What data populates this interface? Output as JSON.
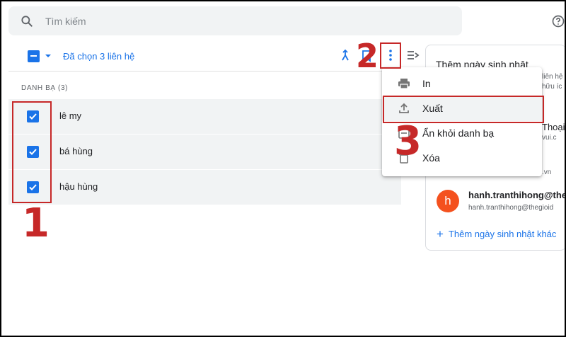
{
  "search": {
    "placeholder": "Tìm kiếm"
  },
  "toolbar": {
    "selected_label": "Đã chọn 3 liên hệ"
  },
  "list": {
    "heading": "DANH BẠ (3)",
    "contacts": [
      {
        "name": "lê my",
        "checked": true
      },
      {
        "name": "bá hùng",
        "checked": true
      },
      {
        "name": "hậu hùng",
        "checked": true
      }
    ]
  },
  "menu": {
    "items": [
      {
        "label": "In",
        "icon": "print-icon"
      },
      {
        "label": "Xuất",
        "icon": "export-icon"
      },
      {
        "label": "Ẩn khỏi danh bạ",
        "icon": "hide-contact-icon"
      },
      {
        "label": "Xóa",
        "icon": "delete-icon"
      }
    ]
  },
  "panel": {
    "title": "Thêm ngày sinh nhật",
    "sub1": "liên hệ",
    "sub2": "hữu íc",
    "partial1": "Thoại",
    "partial2": "vui.c",
    "partial3": ".vn",
    "contact": {
      "avatar_letter": "h",
      "name": "hanh.tranthihong@theg",
      "email": "hanh.tranthihong@thegioid"
    },
    "add_birthday": "Thêm ngày sinh nhật khác"
  },
  "annotations": {
    "step1": "1",
    "step2": "2",
    "step3": "3"
  },
  "colors": {
    "accent": "#1a73e8",
    "annotation": "#c62828",
    "avatar": "#f4511e"
  }
}
